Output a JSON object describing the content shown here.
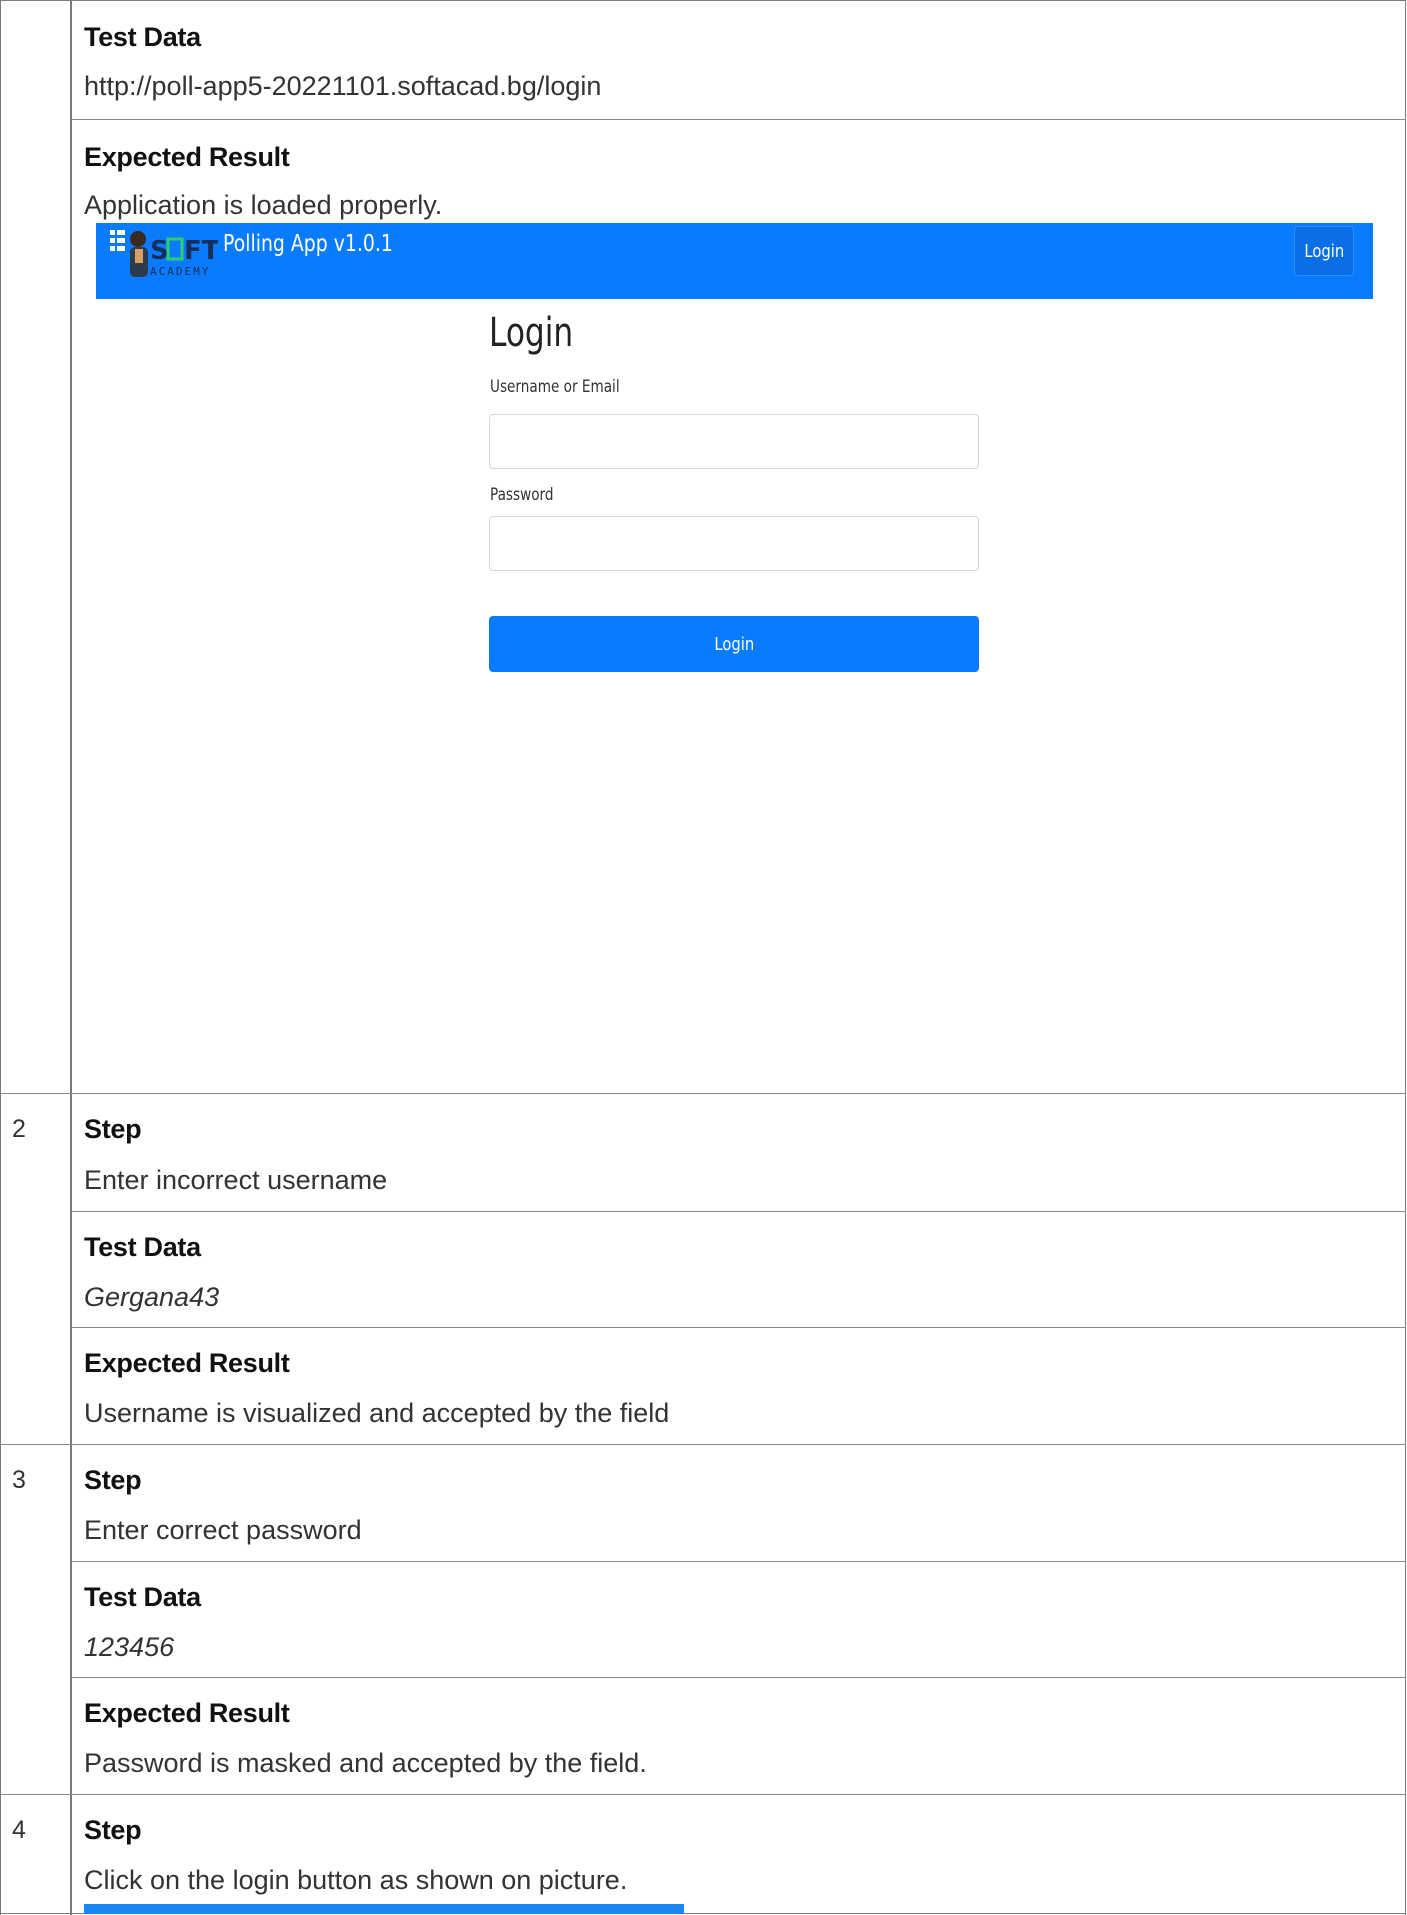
{
  "rows": {
    "first": {
      "test_data_label": "Test Data",
      "test_data_value": "http://poll-app5-20221101.softacad.bg/login",
      "expected_label": "Expected Result",
      "expected_value": "Application is loaded properly."
    },
    "row2": {
      "number": "2",
      "step_label": "Step",
      "step_value": "Enter incorrect username",
      "test_data_label": "Test Data",
      "test_data_value": "Gergana43",
      "expected_label": "Expected Result",
      "expected_value": "Username is visualized and accepted by the field"
    },
    "row3": {
      "number": "3",
      "step_label": "Step",
      "step_value": "Enter correct password",
      "test_data_label": "Test Data",
      "test_data_value": "123456",
      "expected_label": "Expected Result",
      "expected_value": "Password is masked and accepted by the field."
    },
    "row4": {
      "number": "4",
      "step_label": "Step",
      "step_value": "Click on the login button as shown on picture."
    }
  },
  "screenshot": {
    "logo_text": "SOFT",
    "logo_subtext": "ACADEMY",
    "app_title": "Polling App v1.0.1",
    "nav_login": "Login",
    "form_title": "Login",
    "username_label": "Username or Email",
    "username_value": "",
    "password_label": "Password",
    "password_value": "",
    "submit_label": "Login"
  },
  "colors": {
    "navbar": "#0b7bfe",
    "button": "#0b7bfe",
    "border": "#7a7a7a"
  }
}
